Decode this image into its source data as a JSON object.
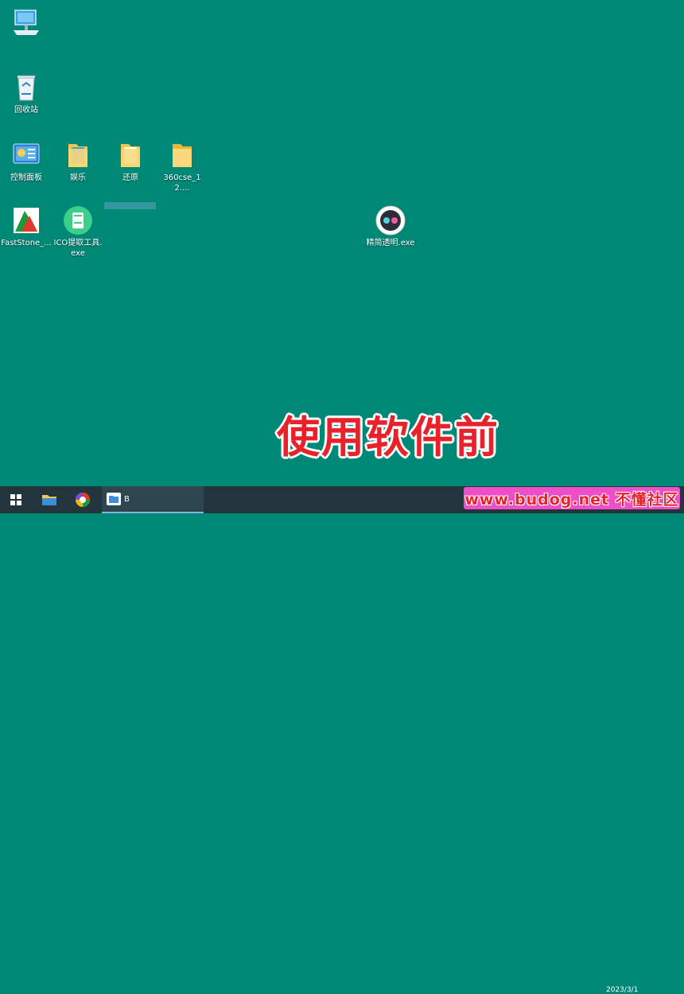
{
  "desktop": {
    "icons": [
      {
        "label": ""
      },
      {
        "label": "回收站"
      },
      {
        "label": "控制面板"
      },
      {
        "label": "娱乐"
      },
      {
        "label": "还原"
      },
      {
        "label": "360cse_12...."
      },
      {
        "label": "FastStone_..."
      },
      {
        "label": "ICO提取工具.exe"
      },
      {
        "label": "精简透明.exe"
      }
    ]
  },
  "overlay": {
    "caption": "使用软件前"
  },
  "taskbar": {
    "active_window_label": "B",
    "watermark": "www.budog.net 不懂社区",
    "clock_date": "2023/3/1"
  },
  "colors": {
    "desktop_bg": "#008877",
    "taskbar_bg": "#22353d",
    "caption_red": "#e8222a"
  }
}
